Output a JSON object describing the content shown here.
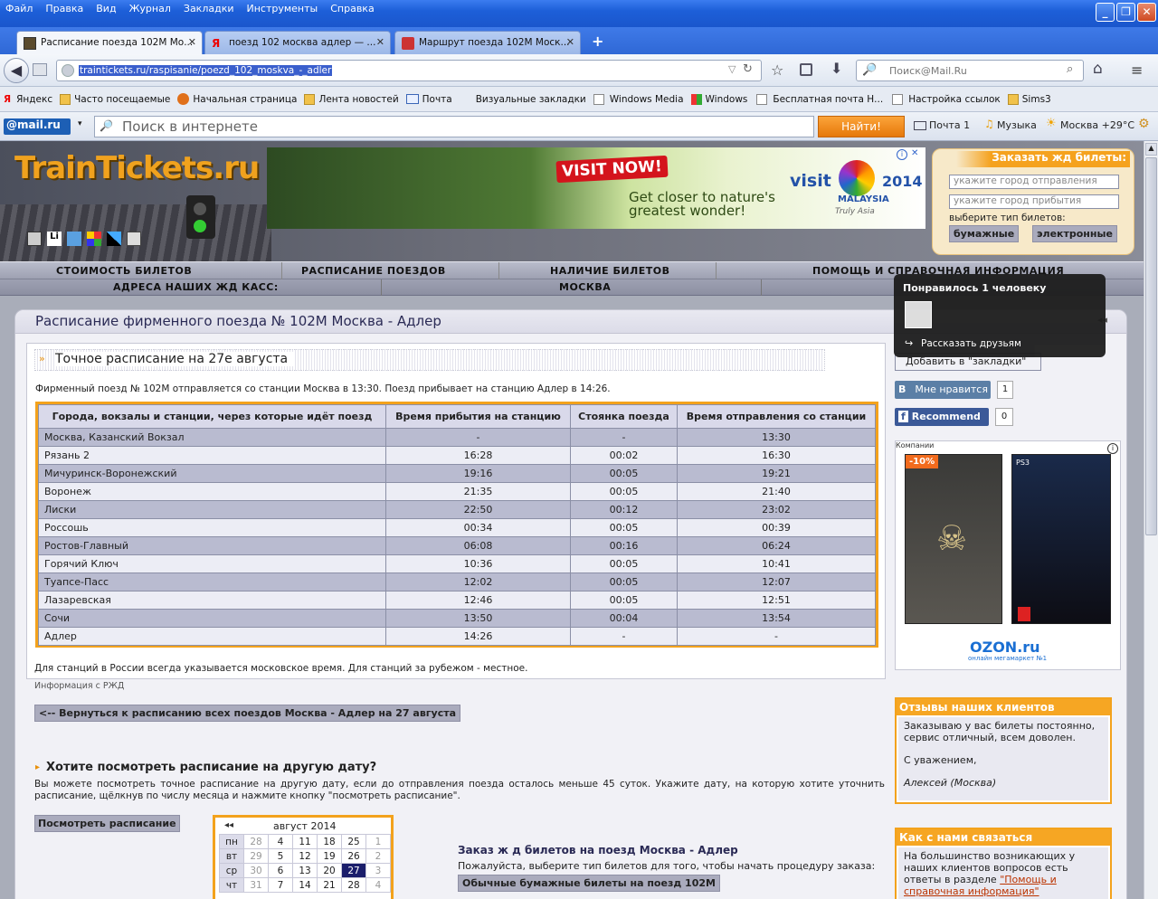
{
  "menu": [
    "Файл",
    "Правка",
    "Вид",
    "Журнал",
    "Закладки",
    "Инструменты",
    "Справка"
  ],
  "tabs": [
    {
      "label": "Расписание поезда 102М Мо...",
      "active": true
    },
    {
      "label": "поезд 102 москва адлер — ...",
      "active": false
    },
    {
      "label": "Маршрут поезда 102М Моск...",
      "active": false
    }
  ],
  "new_tab": "+",
  "address": "traintickets.ru/raspisanie/poezd_102_moskva_-_adler",
  "search_placeholder": "Поиск@Mail.Ru",
  "bookmarks": [
    "Яндекс",
    "Часто посещаемые",
    "Начальная страница",
    "Лента новостей",
    "Почта",
    "Визуальные закладки",
    "Windows Media",
    "Windows",
    "Бесплатная почта Н...",
    "Настройка ссылок",
    "Sims3"
  ],
  "mailbar": {
    "logo": "@mail.ru",
    "search_placeholder": "Поиск в интернете",
    "find": "Найти!",
    "mail": "Почта 1",
    "music": "Музыка",
    "weather": "Москва +29°C"
  },
  "site": {
    "logo": "TrainTickets.ru",
    "ad": {
      "visit": "VISIT NOW!",
      "tagline1": "Get closer to nature's",
      "tagline2": "greatest wonder!",
      "brand1": "visit",
      "brand2": "MALAYSIA",
      "year": "2014",
      "truly": "Truly Asia"
    },
    "order": {
      "title": "Заказать жд билеты:",
      "from": "укажите город отправления",
      "to": "укажите город прибытия",
      "type_label": "выберите тип билетов:",
      "paper": "бумажные",
      "electronic": "электронные"
    },
    "nav": [
      "СТОИМОСТЬ БИЛЕТОВ",
      "РАСПИСАНИЕ ПОЕЗДОВ",
      "НАЛИЧИЕ БИЛЕТОВ",
      "ПОМОЩЬ И СПРАВОЧНАЯ ИНФОРМАЦИЯ"
    ],
    "nav2": [
      "АДРЕСА НАШИХ ЖД КАСС:",
      "МОСКВА"
    ]
  },
  "popup": {
    "title": "Понравилось 1 человеку",
    "share": "Рассказать друзьям"
  },
  "main": {
    "title": "Расписание фирменного поезда № 102М Москва - Адлер",
    "subtitle": "Точное расписание на 27е августа",
    "intro": "Фирменный поезд № 102М отправляется со станции Москва в 13:30. Поезд прибывает на станцию Адлер в 14:26.",
    "headers": [
      "Города, вокзалы и станции, через которые идёт поезд",
      "Время прибытия на станцию",
      "Стоянка поезда",
      "Время отправления со станции"
    ],
    "rows": [
      [
        "Москва, Казанский Вокзал",
        "-",
        "-",
        "13:30"
      ],
      [
        "Рязань 2",
        "16:28",
        "00:02",
        "16:30"
      ],
      [
        "Мичуринск-Воронежский",
        "19:16",
        "00:05",
        "19:21"
      ],
      [
        "Воронеж",
        "21:35",
        "00:05",
        "21:40"
      ],
      [
        "Лиски",
        "22:50",
        "00:12",
        "23:02"
      ],
      [
        "Россошь",
        "00:34",
        "00:05",
        "00:39"
      ],
      [
        "Ростов-Главный",
        "06:08",
        "00:16",
        "06:24"
      ],
      [
        "Горячий Ключ",
        "10:36",
        "00:05",
        "10:41"
      ],
      [
        "Туапсе-Пасс",
        "12:02",
        "00:05",
        "12:07"
      ],
      [
        "Лазаревская",
        "12:46",
        "00:05",
        "12:51"
      ],
      [
        "Сочи",
        "13:50",
        "00:04",
        "13:54"
      ],
      [
        "Адлер",
        "14:26",
        "-",
        "-"
      ]
    ],
    "note": "Для станций в России всегда указывается московское время. Для станций за рубежом - местное.",
    "source": "Информация с РЖД",
    "back": "<-- Вернуться к расписанию всех поездов Москва - Адлер на 27 августа",
    "other_date_title": "Хотите посмотреть расписание на другую дату?",
    "other_date_text": "Вы можете посмотреть точное расписание на другую дату, если до отправления поезда осталось меньше 45 суток. Укажите дату, на которую хотите уточнить расписание, щёлкнув по числу месяца и нажмите кнопку \"посмотреть расписание\".",
    "view_btn": "Посмотреть расписание",
    "order_title": "Заказ ж д билетов на поезд Москва - Адлер",
    "order_text": "Пожалуйста, выберите тип билетов для того, чтобы начать процедуру заказа:",
    "order_btn": "Обычные бумажные билеты на поезд 102М"
  },
  "calendar": {
    "month": "август 2014",
    "prev": "◂◂",
    "rows": [
      [
        "пн",
        "28",
        "4",
        "11",
        "18",
        "25",
        "1"
      ],
      [
        "вт",
        "29",
        "5",
        "12",
        "19",
        "26",
        "2"
      ],
      [
        "ср",
        "30",
        "6",
        "13",
        "20",
        "27",
        "3"
      ],
      [
        "чт",
        "31",
        "7",
        "14",
        "21",
        "28",
        "4"
      ]
    ],
    "selected": "27"
  },
  "side": {
    "bookmark": "Добавить в \"закладки\"",
    "vk": "Мне нравится",
    "vk_count": "1",
    "fb": "Recommend",
    "fb_count": "0",
    "ad_label": "Компании",
    "discount": "-10%",
    "ozon": "OZON.ru",
    "ozon_sub": "онлайн мегамаркет №1",
    "reviews_title": "Отзывы наших клиентов",
    "review1": "Заказываю у вас билеты постоянно, сервис отличный, всем доволен.",
    "review2": "С уважением,",
    "review3": "Алексей (Москва)",
    "contact_title": "Как с нами связаться",
    "contact_text": "На большинство возникающих у наших клиентов вопросов есть ответы в разделе ",
    "contact_link": "\"Помощь и справочная информация\""
  }
}
